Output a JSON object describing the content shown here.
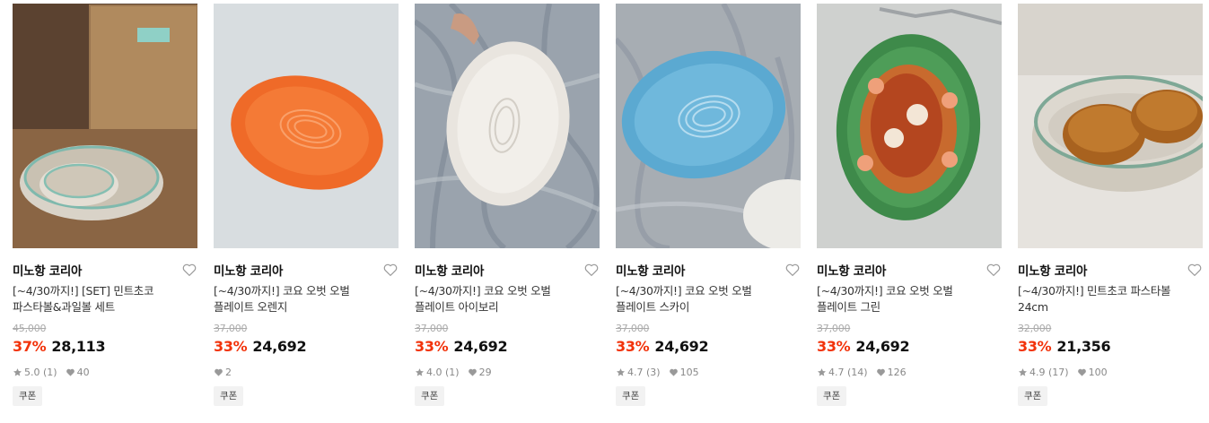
{
  "products": [
    {
      "brand": "미노항 코리아",
      "title_line1": "[~4/30까지!] [SET] 민트초코",
      "title_line2": "파스타볼&과일볼 세트",
      "original_price": "45,000",
      "discount": "37%",
      "price": "28,113",
      "rating": "5.0 (1)",
      "likes": "40",
      "badge": "쿠폰",
      "image_icon": "mint-pasta-bowl-set-photo"
    },
    {
      "brand": "미노항 코리아",
      "title_line1": "[~4/30까지!] 코요 오벗 오벌",
      "title_line2": "플레이트 오렌지",
      "original_price": "37,000",
      "discount": "33%",
      "price": "24,692",
      "rating": "",
      "likes": "2",
      "badge": "쿠폰",
      "image_icon": "orange-oval-plate-photo"
    },
    {
      "brand": "미노항 코리아",
      "title_line1": "[~4/30까지!] 코요 오벗 오벌",
      "title_line2": "플레이트 아이보리",
      "original_price": "37,000",
      "discount": "33%",
      "price": "24,692",
      "rating": "4.0 (1)",
      "likes": "29",
      "badge": "쿠폰",
      "image_icon": "ivory-oval-plate-photo"
    },
    {
      "brand": "미노항 코리아",
      "title_line1": "[~4/30까지!] 코요 오벗 오벌",
      "title_line2": "플레이트 스카이",
      "original_price": "37,000",
      "discount": "33%",
      "price": "24,692",
      "rating": "4.7 (3)",
      "likes": "105",
      "badge": "쿠폰",
      "image_icon": "sky-blue-oval-plate-photo"
    },
    {
      "brand": "미노항 코리아",
      "title_line1": "[~4/30까지!] 코요 오벗 오벌",
      "title_line2": "플레이트 그린",
      "original_price": "37,000",
      "discount": "33%",
      "price": "24,692",
      "rating": "4.7 (14)",
      "likes": "126",
      "badge": "쿠폰",
      "image_icon": "green-oval-plate-pasta-photo"
    },
    {
      "brand": "미노항 코리아",
      "title_line1": "[~4/30까지!] 민트초코 파스타볼",
      "title_line2": "24cm",
      "original_price": "32,000",
      "discount": "33%",
      "price": "21,356",
      "rating": "4.9 (17)",
      "likes": "100",
      "badge": "쿠폰",
      "image_icon": "mint-pasta-bowl-bread-photo"
    }
  ],
  "colors": {
    "discount": "#f2330b",
    "muted": "#888888",
    "coupon_bg": "#f2f2f2"
  },
  "icons": {
    "wishlist": "heart-outline-icon",
    "rating": "star-icon",
    "likes": "heart-filled-icon"
  }
}
